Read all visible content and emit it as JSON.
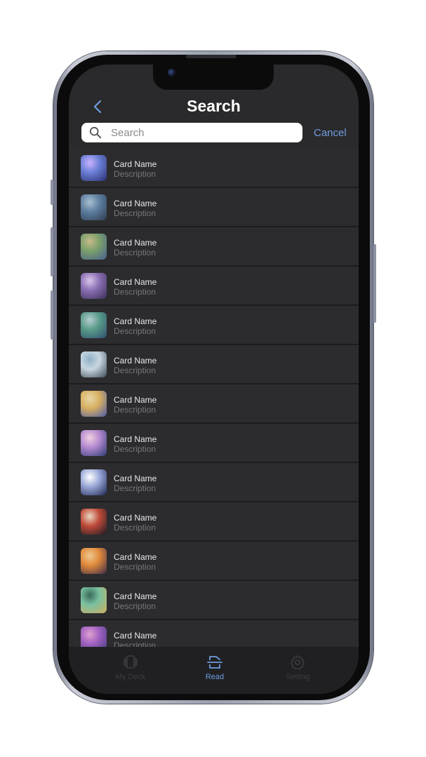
{
  "header": {
    "title": "Search",
    "back_icon": "chevron-left-icon"
  },
  "search": {
    "placeholder": "Search",
    "value": "",
    "cancel_label": "Cancel"
  },
  "results": [
    {
      "name": "Card Name",
      "description": "Description"
    },
    {
      "name": "Card Name",
      "description": "Description"
    },
    {
      "name": "Card Name",
      "description": "Description"
    },
    {
      "name": "Card Name",
      "description": "Description"
    },
    {
      "name": "Card Name",
      "description": "Description"
    },
    {
      "name": "Card Name",
      "description": "Description"
    },
    {
      "name": "Card Name",
      "description": "Description"
    },
    {
      "name": "Card Name",
      "description": "Description"
    },
    {
      "name": "Card Name",
      "description": "Description"
    },
    {
      "name": "Card Name",
      "description": "Description"
    },
    {
      "name": "Card Name",
      "description": "Description"
    },
    {
      "name": "Card Name",
      "description": "Description"
    },
    {
      "name": "Card Name",
      "description": "Description"
    }
  ],
  "tabbar": {
    "tabs": [
      {
        "label": "My Deck",
        "icon": "cards-stack-icon",
        "active": false
      },
      {
        "label": "Read",
        "icon": "scan-icon",
        "active": true
      },
      {
        "label": "Setting",
        "icon": "gear-icon",
        "active": false
      }
    ]
  },
  "colors": {
    "accent": "#6e9de0",
    "background": "#2a2a2c",
    "inactive_tab": "#3c3c40"
  }
}
